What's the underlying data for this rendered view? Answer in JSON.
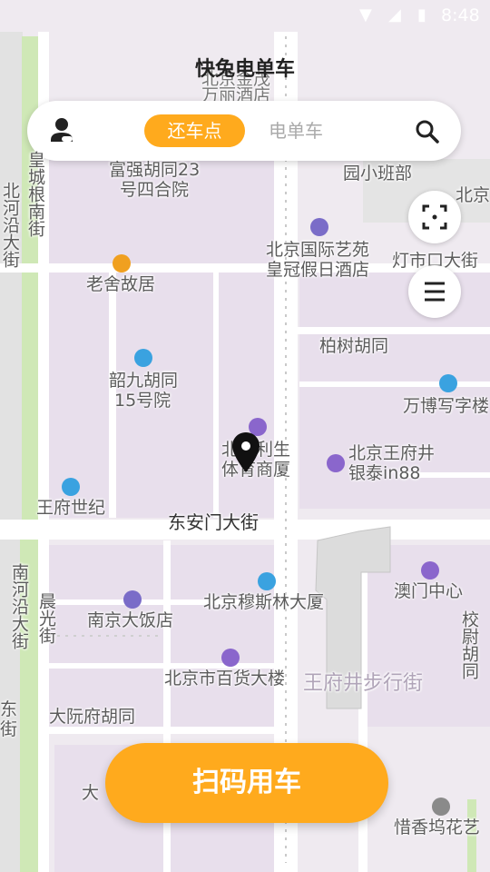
{
  "status": {
    "time": "8:48",
    "wifi_icon": "wifi-icon",
    "signal_icon": "signal-icon",
    "battery_icon": "battery-icon"
  },
  "header": {
    "title": "快兔电单车"
  },
  "tabs": [
    {
      "label": "还车点",
      "active": true
    },
    {
      "label": "电单车",
      "active": false
    }
  ],
  "icons": {
    "profile": "profile-icon",
    "search": "search-icon",
    "locate": "locate-icon",
    "menu": "menu-icon"
  },
  "action": {
    "scan_label": "扫码用车"
  },
  "colors": {
    "accent": "#ffaa1d",
    "map_bg": "#efeaf0",
    "road": "#ffffff",
    "green": "#cfe8b6"
  },
  "map": {
    "labels": {
      "jinmao": "北京金茂",
      "wanli": "万丽酒店",
      "fuqiang1": "富强胡同23",
      "fuqiang2": "号四合院",
      "yuanxiaobanbu": "园小班部",
      "beijing_edge": "北京",
      "huangchenggen": "皇城根南街",
      "beiheyan": "北河沿大街",
      "yiyuan1": "北京国际艺苑",
      "yiyuan2": "皇冠假日酒店",
      "dengshikou": "灯市口大街",
      "laoshe": "老舍故居",
      "baishu": "柏树胡同",
      "shaojiu1": "韶九胡同",
      "shaojiu2": "15号院",
      "wanbo": "万博写字楼",
      "lisheng1": "北京利生",
      "lisheng2": "体育商厦",
      "yintai1": "北京王府井",
      "yintai2": "银泰in88",
      "wangfushiji": "王府世纪",
      "donganmen": "东安门大街",
      "nanheyan": "南河沿大街",
      "chenguang": "晨光街",
      "musilin": "北京穆斯林大厦",
      "aomen": "澳门中心",
      "nanjing": "南京大饭店",
      "xiaowei": "校尉胡同",
      "baihuo": "北京市百货大楼",
      "buxingjie": "王府井步行街",
      "dayuanfu": "大阮府胡同",
      "da": "大",
      "xixiang": "惜香坞花艺",
      "dong": "东",
      "jie": "街"
    }
  }
}
